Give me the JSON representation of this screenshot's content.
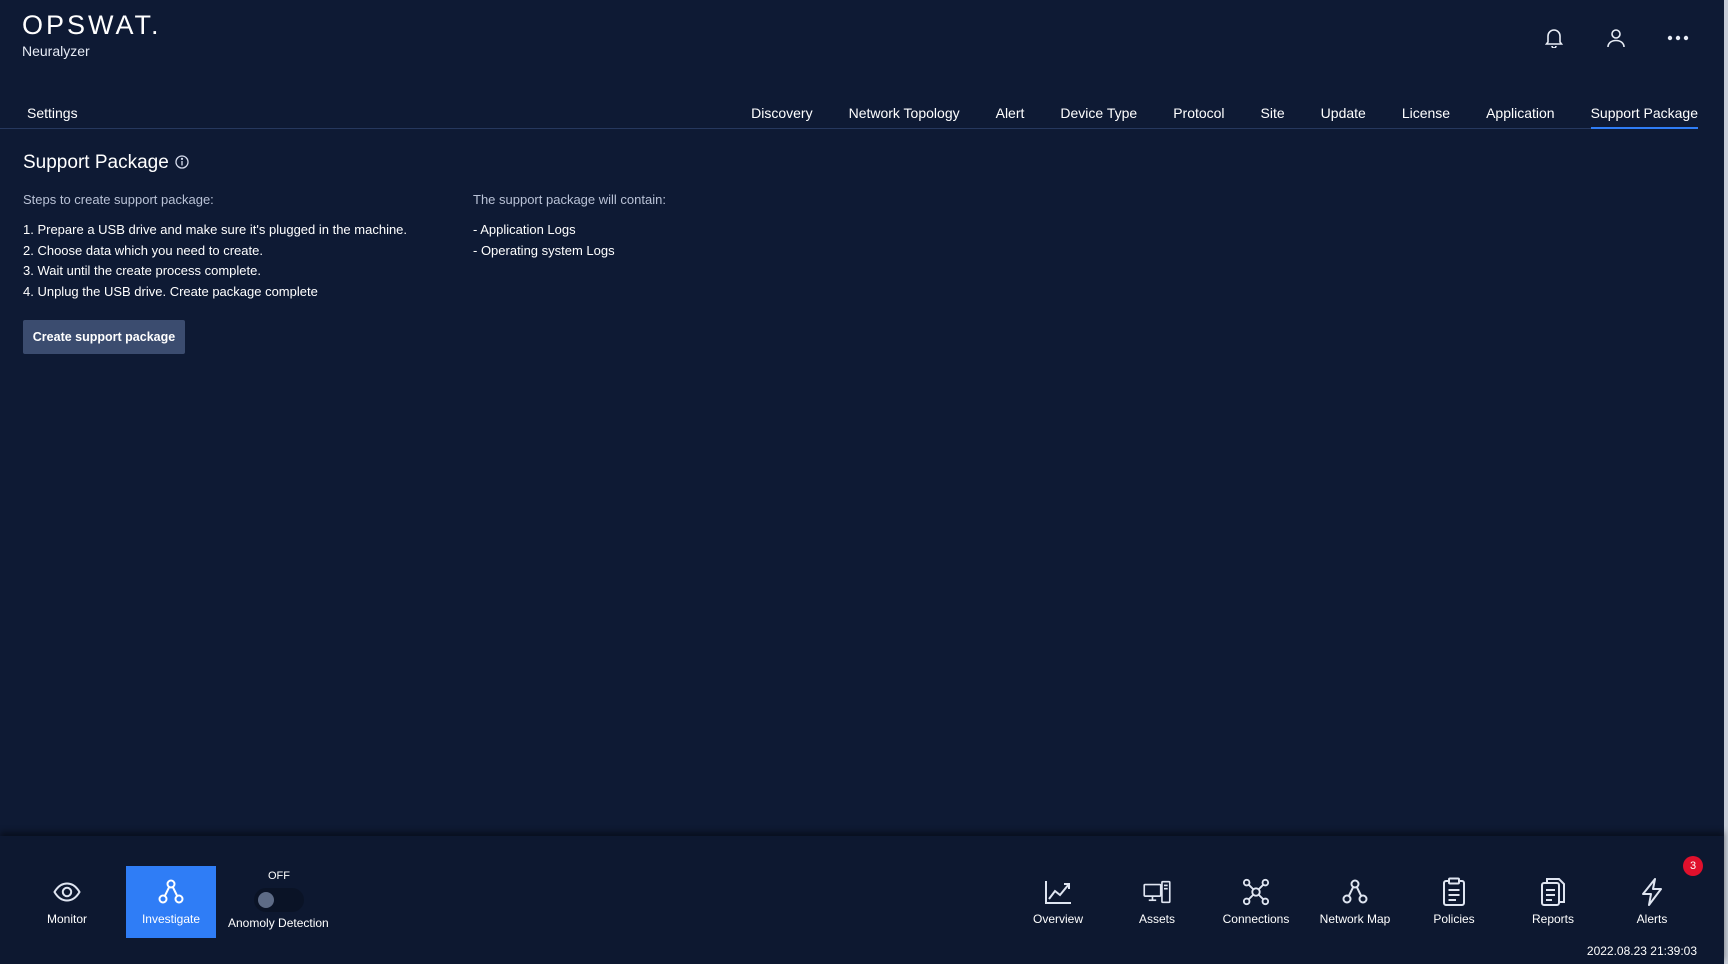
{
  "brand": {
    "logo": "OPSWAT.",
    "product": "Neuralyzer"
  },
  "header_icons": [
    "bell-icon",
    "user-icon",
    "more-icon"
  ],
  "tabs": {
    "settings_label": "Settings",
    "items": [
      {
        "label": "Discovery"
      },
      {
        "label": "Network Topology"
      },
      {
        "label": "Alert"
      },
      {
        "label": "Device Type"
      },
      {
        "label": "Protocol"
      },
      {
        "label": "Site"
      },
      {
        "label": "Update"
      },
      {
        "label": "License"
      },
      {
        "label": "Application"
      },
      {
        "label": "Support Package",
        "active": true
      }
    ]
  },
  "page": {
    "title": "Support Package",
    "steps_heading": "Steps to create support package:",
    "steps": [
      "1. Prepare a USB drive and make sure it's plugged in the machine.",
      "2. Choose data which you need to create.",
      "3. Wait until the create process complete.",
      "4. Unplug the USB drive. Create package complete"
    ],
    "contents_heading": "The support package will contain:",
    "contents": [
      "- Application Logs",
      "- Operating system Logs"
    ],
    "create_button": "Create support package"
  },
  "bottom_nav": {
    "left": [
      {
        "label": "Monitor",
        "icon": "eye-icon"
      },
      {
        "label": "Investigate",
        "icon": "investigate-icon",
        "active": true
      }
    ],
    "anomaly": {
      "state": "OFF",
      "label": "Anomoly Detection",
      "enabled": false
    },
    "right": [
      {
        "label": "Overview",
        "icon": "chart-line-icon"
      },
      {
        "label": "Assets",
        "icon": "assets-icon"
      },
      {
        "label": "Connections",
        "icon": "connections-icon"
      },
      {
        "label": "Network Map",
        "icon": "network-map-icon"
      },
      {
        "label": "Policies",
        "icon": "clipboard-icon"
      },
      {
        "label": "Reports",
        "icon": "reports-icon"
      },
      {
        "label": "Alerts",
        "icon": "lightning-icon"
      }
    ],
    "alerts_badge": "3",
    "timestamp": "2022.08.23 21:39:03"
  },
  "colors": {
    "background": "#0e1a34",
    "accent": "#2f7df6",
    "badge": "#e0102c",
    "button": "#3b4c6f"
  }
}
